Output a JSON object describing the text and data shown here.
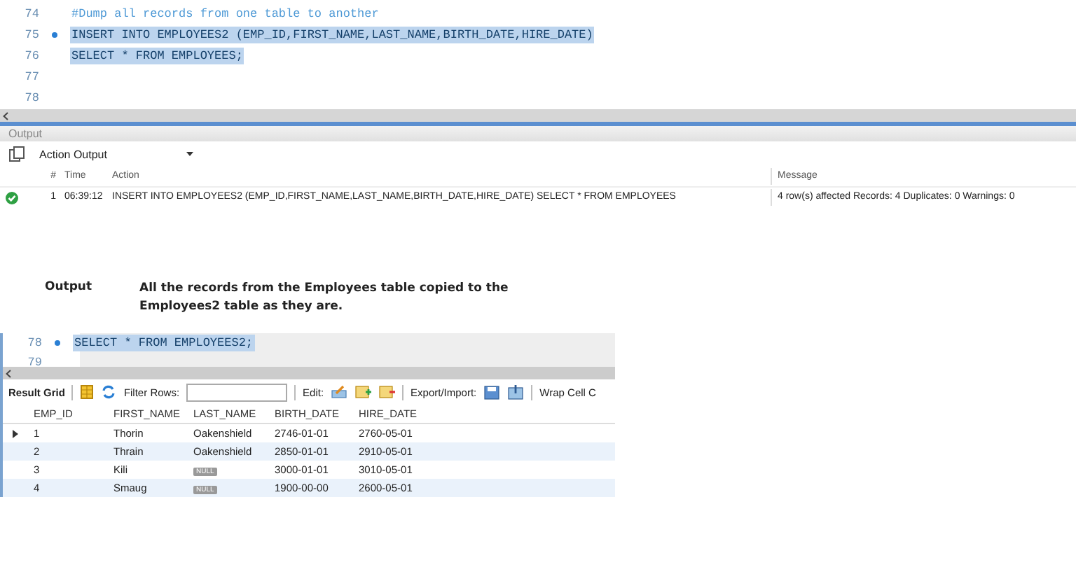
{
  "editor": {
    "lines": [
      {
        "number": "74",
        "text": "#Dump all records from one table to another",
        "kind": "comment",
        "marked": false,
        "selected": false
      },
      {
        "number": "75",
        "text": "INSERT INTO EMPLOYEES2 (EMP_ID,FIRST_NAME,LAST_NAME,BIRTH_DATE,HIRE_DATE)",
        "kind": "code",
        "marked": true,
        "selected": true
      },
      {
        "number": "76",
        "text": "SELECT * FROM EMPLOYEES;",
        "kind": "code",
        "marked": false,
        "selected": true
      },
      {
        "number": "77"
      },
      {
        "number": "78"
      }
    ]
  },
  "output_panel": {
    "title": "Output",
    "dropdown": "Action Output",
    "columns": [
      "#",
      "Time",
      "Action",
      "Message"
    ],
    "rows": [
      {
        "succeeded": true,
        "number": "1",
        "time": "06:39:12",
        "action": "INSERT INTO EMPLOYEES2 (EMP_ID,FIRST_NAME,LAST_NAME,BIRTH_DATE,HIRE_DATE) SELECT * FROM EMPLOYEES",
        "message": "4 row(s) affected Records: 4  Duplicates: 0  Warnings: 0"
      }
    ]
  },
  "caption": {
    "label": "Output",
    "text": "All the records from the Employees table copied to the Employees2 table as they are."
  },
  "editor2": {
    "lines": [
      {
        "number": "78",
        "text": "SELECT * FROM EMPLOYEES2;",
        "kind": "code",
        "marked": true,
        "selected": true
      },
      {
        "number": "79"
      }
    ]
  },
  "result_grid": {
    "toolbar": {
      "title": "Result Grid",
      "filter_label": "Filter Rows:",
      "edit_label": "Edit:",
      "export_label": "Export/Import:",
      "wrap_label": "Wrap Cell C"
    },
    "columns": [
      "EMP_ID",
      "FIRST_NAME",
      "LAST_NAME",
      "BIRTH_DATE",
      "HIRE_DATE"
    ],
    "rows": [
      {
        "current": true,
        "cells": [
          {
            "kind": "text",
            "value": "1"
          },
          {
            "kind": "text",
            "value": "Thorin"
          },
          {
            "kind": "text",
            "value": "Oakenshield"
          },
          {
            "kind": "text",
            "value": "2746-01-01"
          },
          {
            "kind": "text",
            "value": "2760-05-01"
          }
        ]
      },
      {
        "current": false,
        "cells": [
          {
            "kind": "text",
            "value": "2"
          },
          {
            "kind": "text",
            "value": "Thrain"
          },
          {
            "kind": "text",
            "value": "Oakenshield"
          },
          {
            "kind": "text",
            "value": "2850-01-01"
          },
          {
            "kind": "text",
            "value": "2910-05-01"
          }
        ]
      },
      {
        "current": false,
        "cells": [
          {
            "kind": "text",
            "value": "3"
          },
          {
            "kind": "text",
            "value": "Kili"
          },
          {
            "kind": "null",
            "value": "NULL"
          },
          {
            "kind": "text",
            "value": "3000-01-01"
          },
          {
            "kind": "text",
            "value": "3010-05-01"
          }
        ]
      },
      {
        "current": false,
        "cells": [
          {
            "kind": "text",
            "value": "4"
          },
          {
            "kind": "text",
            "value": "Smaug"
          },
          {
            "kind": "null",
            "value": "NULL"
          },
          {
            "kind": "text",
            "value": "1900-00-00"
          },
          {
            "kind": "text",
            "value": "2600-05-01"
          }
        ]
      }
    ]
  }
}
